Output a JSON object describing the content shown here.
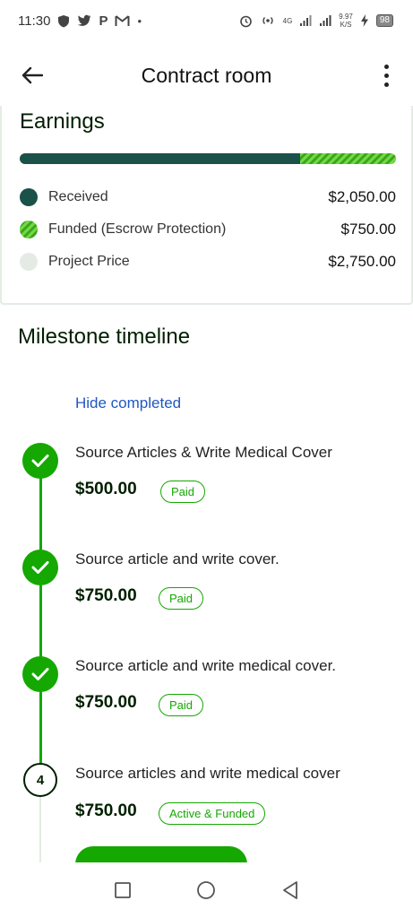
{
  "status_bar": {
    "time": "11:30",
    "left_icons": [
      "shield-icon",
      "twitter-icon",
      "p-icon",
      "gmail-icon",
      "dot-icon"
    ],
    "right_icons": [
      "alarm-icon",
      "hotspot-icon",
      "signal-icon",
      "signal-icon",
      "charging-icon"
    ],
    "network": "4G",
    "speed_value": "9.97",
    "speed_unit": "K/S",
    "battery": "98"
  },
  "header": {
    "title": "Contract room",
    "back_icon": "arrow-left-icon",
    "menu_icon": "more-vertical-icon"
  },
  "earnings": {
    "title": "Earnings",
    "progress": {
      "received_fraction": 0.745,
      "funded_fraction": 0.255
    },
    "rows": [
      {
        "label": "Received",
        "value": "$2,050.00",
        "color": "#1a5148"
      },
      {
        "label": "Funded (Escrow Protection)",
        "value": "$750.00",
        "color": "#3ea31c"
      },
      {
        "label": "Project Price",
        "value": "$2,750.00",
        "color": "#e4ebe4"
      }
    ]
  },
  "milestones": {
    "title": "Milestone timeline",
    "hide_link": "Hide completed",
    "items": [
      {
        "status_icon": "check-icon",
        "title": "Source Articles & Write Medical Cover",
        "amount": "$500.00",
        "badge": "Paid"
      },
      {
        "status_icon": "check-icon",
        "title": "Source article and write cover.",
        "amount": "$750.00",
        "badge": "Paid"
      },
      {
        "status_icon": "check-icon",
        "title": "Source article and write medical cover.",
        "amount": "$750.00",
        "badge": "Paid"
      },
      {
        "status_icon": "number",
        "number": "4",
        "title": "Source articles and write medical cover",
        "amount": "$750.00",
        "badge": "Active & Funded"
      }
    ]
  },
  "nav_bar": {
    "icons": [
      "square-icon",
      "circle-icon",
      "triangle-back-icon"
    ]
  },
  "colors": {
    "primary_green": "#14a800",
    "dark_teal": "#1a5148",
    "link_blue": "#1f57c3",
    "text_dark": "#001e00"
  }
}
